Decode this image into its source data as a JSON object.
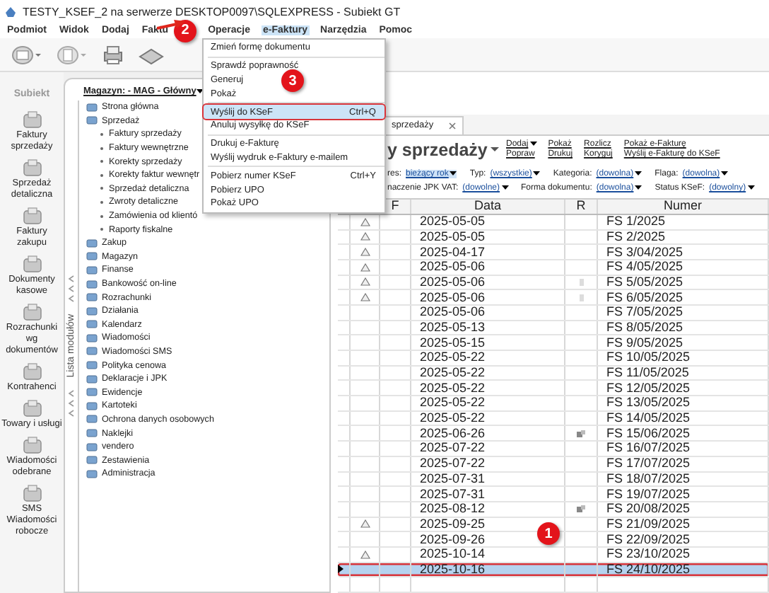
{
  "window": {
    "title": "TESTY_KSEF_2 na serwerze DESKTOP0097\\SQLEXPRESS - Subiekt GT"
  },
  "menu_bar": [
    {
      "label": "Podmiot",
      "selected": false
    },
    {
      "label": "Widok",
      "selected": false
    },
    {
      "label": "Dodaj",
      "selected": false
    },
    {
      "label": "Faktu",
      "selected": false
    },
    {
      "label": "Operacje",
      "selected": false
    },
    {
      "label": "e-Faktury",
      "selected": true
    },
    {
      "label": "Narzędzia",
      "selected": false
    },
    {
      "label": "Pomoc",
      "selected": false
    }
  ],
  "sidebar": {
    "logo": "Subiekt",
    "items": [
      {
        "label": "Faktury sprzedaży"
      },
      {
        "label": "Sprzedaż detaliczna"
      },
      {
        "label": "Faktury zakupu"
      },
      {
        "label": "Dokumenty kasowe"
      },
      {
        "label": "Rozrachunki wg dokumentów"
      },
      {
        "label": "Kontrahenci"
      },
      {
        "label": "Towary i usługi"
      },
      {
        "label": "Wiadomości odebrane"
      },
      {
        "label": "SMS Wiadomości robocze"
      }
    ]
  },
  "modules": {
    "store_picker": "Magazyn: - MAG - Główny",
    "tab_label": "Lista modułów",
    "items": [
      {
        "label": "Strona główna"
      },
      {
        "label": "Sprzedaż",
        "children": [
          {
            "label": "Faktury sprzedaży"
          },
          {
            "label": "Faktury wewnętrzne"
          },
          {
            "label": "Korekty sprzedaży"
          },
          {
            "label": "Korekty faktur wewnętr"
          },
          {
            "label": "Sprzedaż detaliczna"
          },
          {
            "label": "Zwroty detaliczne"
          },
          {
            "label": "Zamówienia od klientó"
          },
          {
            "label": "Raporty fiskalne"
          }
        ]
      },
      {
        "label": "Zakup"
      },
      {
        "label": "Magazyn"
      },
      {
        "label": "Finanse"
      },
      {
        "label": "Bankowość on-line"
      },
      {
        "label": "Rozrachunki"
      },
      {
        "label": "Działania"
      },
      {
        "label": "Kalendarz"
      },
      {
        "label": "Wiadomości"
      },
      {
        "label": "Wiadomości SMS"
      },
      {
        "label": "Polityka cenowa"
      },
      {
        "label": "Deklaracje i JPK"
      },
      {
        "label": "Ewidencje"
      },
      {
        "label": "Kartoteki"
      },
      {
        "label": "Ochrona danych osobowych"
      },
      {
        "label": "Naklejki"
      },
      {
        "label": "vendero"
      },
      {
        "label": "Zestawienia"
      },
      {
        "label": "Administracja"
      }
    ]
  },
  "document_tab": {
    "label": "sprzedaży"
  },
  "heading": "y sprzedaży",
  "actions": [
    {
      "label": "Dodaj",
      "dropdown": true
    },
    {
      "label": "Popraw",
      "dropdown": false
    },
    {
      "label": "Pokaż",
      "dropdown": false
    },
    {
      "label": "Drukuj",
      "dropdown": false
    },
    {
      "label": "Rozlicz",
      "dropdown": false
    },
    {
      "label": "Koryguj",
      "dropdown": false
    },
    {
      "label": "Pokaż e-Fakturę",
      "dropdown": false
    },
    {
      "label": "Wyślij e-Fakturę do KSeF",
      "dropdown": false
    }
  ],
  "filters": [
    [
      {
        "label": "res:",
        "value": "bieżący rok",
        "selected": true
      },
      {
        "label": "Typ:",
        "value": "(wszystkie)",
        "selected": false
      },
      {
        "label": "Kategoria:",
        "value": "(dowolna)",
        "selected": false
      },
      {
        "label": "Flaga:",
        "value": "(dowolna)",
        "selected": false
      }
    ],
    [
      {
        "label": "naczenie JPK VAT:",
        "value": "(dowolne)",
        "selected": false
      },
      {
        "label": "Forma dokumentu:",
        "value": "(dowolna)",
        "selected": false
      },
      {
        "label": "Status KSeF:",
        "value": "(dowolny)",
        "selected": false
      }
    ]
  ],
  "table": {
    "columns": [
      "F",
      "Data",
      "R",
      "Numer"
    ],
    "rows": [
      {
        "warning": true,
        "date": "2025-05-05",
        "number": "FS 1/2025",
        "selected": false
      },
      {
        "warning": true,
        "date": "2025-05-05",
        "number": "FS 2/2025",
        "selected": false
      },
      {
        "warning": true,
        "date": "2025-04-17",
        "number": "FS 3/04/2025",
        "selected": false
      },
      {
        "warning": true,
        "date": "2025-05-06",
        "number": "FS 4/05/2025",
        "selected": false
      },
      {
        "warning": true,
        "date": "2025-05-06",
        "kind": "note",
        "number": "FS 5/05/2025",
        "selected": false
      },
      {
        "warning": true,
        "date": "2025-05-06",
        "kind": "note",
        "number": "FS 6/05/2025",
        "selected": false
      },
      {
        "warning": false,
        "date": "2025-05-06",
        "number": "FS 7/05/2025",
        "selected": false
      },
      {
        "warning": false,
        "date": "2025-05-13",
        "number": "FS 8/05/2025",
        "selected": false
      },
      {
        "warning": false,
        "date": "2025-05-15",
        "number": "FS 9/05/2025",
        "selected": false
      },
      {
        "warning": false,
        "date": "2025-05-22",
        "number": "FS 10/05/2025",
        "selected": false
      },
      {
        "warning": false,
        "date": "2025-05-22",
        "number": "FS 11/05/2025",
        "selected": false
      },
      {
        "warning": false,
        "date": "2025-05-22",
        "number": "FS 12/05/2025",
        "selected": false
      },
      {
        "warning": false,
        "date": "2025-05-22",
        "number": "FS 13/05/2025",
        "selected": false
      },
      {
        "warning": false,
        "date": "2025-05-22",
        "number": "FS 14/05/2025",
        "selected": false
      },
      {
        "warning": false,
        "date": "2025-06-26",
        "kind": "pair",
        "number": "FS 15/06/2025",
        "selected": false
      },
      {
        "warning": false,
        "date": "2025-07-22",
        "number": "FS 16/07/2025",
        "selected": false
      },
      {
        "warning": false,
        "date": "2025-07-22",
        "number": "FS 17/07/2025",
        "selected": false
      },
      {
        "warning": false,
        "date": "2025-07-31",
        "number": "FS 18/07/2025",
        "selected": false
      },
      {
        "warning": false,
        "date": "2025-07-31",
        "number": "FS 19/07/2025",
        "selected": false
      },
      {
        "warning": false,
        "date": "2025-08-12",
        "kind": "pair",
        "number": "FS 20/08/2025",
        "selected": false
      },
      {
        "warning": true,
        "date": "2025-09-25",
        "number": "FS 21/09/2025",
        "selected": false
      },
      {
        "warning": false,
        "date": "2025-09-26",
        "number": "FS 22/09/2025",
        "selected": false
      },
      {
        "warning": true,
        "date": "2025-10-14",
        "number": "FS 23/10/2025",
        "selected": false
      },
      {
        "warning": false,
        "date": "2025-10-16",
        "number": "FS 24/10/2025",
        "selected": true
      }
    ]
  },
  "context_menu": {
    "groups": [
      [
        {
          "label": "Zmień formę dokumentu",
          "selected": false
        }
      ],
      [
        {
          "label": "Sprawdź poprawność",
          "selected": false
        },
        {
          "label": "Generuj",
          "selected": false
        },
        {
          "label": "Pokaż",
          "selected": false
        }
      ],
      [
        {
          "label": "Wyślij do KSeF",
          "shortcut": "Ctrl+Q",
          "selected": true
        },
        {
          "label": "Anuluj wysyłkę do KSeF",
          "selected": false
        }
      ],
      [
        {
          "label": "Drukuj e-Fakturę",
          "selected": false
        },
        {
          "label": "Wyślij wydruk e-Faktury e-mailem",
          "selected": false
        }
      ],
      [
        {
          "label": "Pobierz numer KSeF",
          "shortcut": "Ctrl+Y",
          "selected": false
        },
        {
          "label": "Pobierz UPO",
          "selected": false
        },
        {
          "label": "Pokaż UPO",
          "selected": false
        }
      ]
    ]
  },
  "annotations": [
    {
      "label": "2"
    },
    {
      "label": "3"
    },
    {
      "label": "1"
    }
  ]
}
